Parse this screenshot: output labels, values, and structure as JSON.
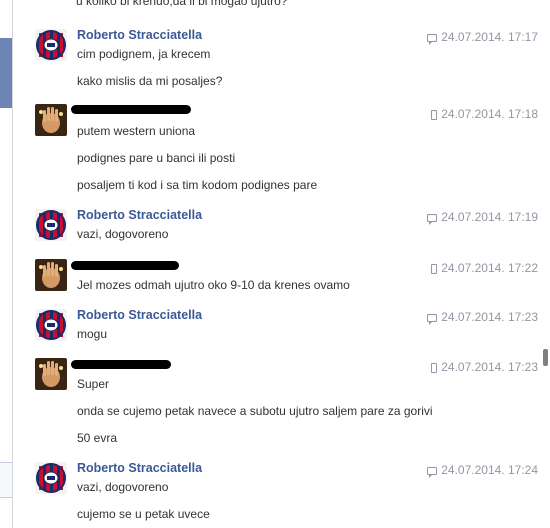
{
  "top_partial_message": "u koliko bi krenuo,da li bi mogao ujutro?",
  "colors": {
    "sender_link": "#3b5998",
    "timestamp": "#9197a3",
    "text": "#333333",
    "redaction": "#000000"
  },
  "groups": [
    {
      "sender": "Roberto Stracciatella",
      "avatar_icon": "club-crest-icon",
      "source_icon": "chat-bubble-icon",
      "timestamp": "24.07.2014. 17:17",
      "lines": [
        "cim podignem, ja krecem",
        "kako mislis da mi posaljes?"
      ]
    },
    {
      "sender": "",
      "sender_redacted": true,
      "avatar_icon": "hand-photo-icon",
      "source_icon": "mobile-phone-icon",
      "timestamp": "24.07.2014. 17:18",
      "lines": [
        "putem western uniona",
        "podignes pare u banci ili posti",
        "posaljem ti kod i sa tim kodom podignes pare"
      ]
    },
    {
      "sender": "Roberto Stracciatella",
      "avatar_icon": "club-crest-icon",
      "source_icon": "chat-bubble-icon",
      "timestamp": "24.07.2014. 17:19",
      "lines": [
        "vazi, dogovoreno"
      ]
    },
    {
      "sender": "",
      "sender_redacted": true,
      "avatar_icon": "hand-photo-icon",
      "source_icon": "mobile-phone-icon",
      "timestamp": "24.07.2014. 17:22",
      "lines": [
        "Jel mozes odmah ujutro oko 9-10 da krenes ovamo"
      ]
    },
    {
      "sender": "Roberto Stracciatella",
      "avatar_icon": "club-crest-icon",
      "source_icon": "chat-bubble-icon",
      "timestamp": "24.07.2014. 17:23",
      "lines": [
        "mogu"
      ]
    },
    {
      "sender": "",
      "sender_redacted": true,
      "avatar_icon": "hand-photo-icon",
      "source_icon": "mobile-phone-icon",
      "timestamp": "24.07.2014. 17:23",
      "lines": [
        "Super",
        "onda se cujemo petak navece a subotu ujutro saljem pare za gorivi",
        "50 evra"
      ]
    },
    {
      "sender": "Roberto Stracciatella",
      "avatar_icon": "club-crest-icon",
      "source_icon": "chat-bubble-icon",
      "timestamp": "24.07.2014. 17:24",
      "lines": [
        "vazi, dogovoreno",
        "cujemo se u petak uvece"
      ]
    }
  ]
}
